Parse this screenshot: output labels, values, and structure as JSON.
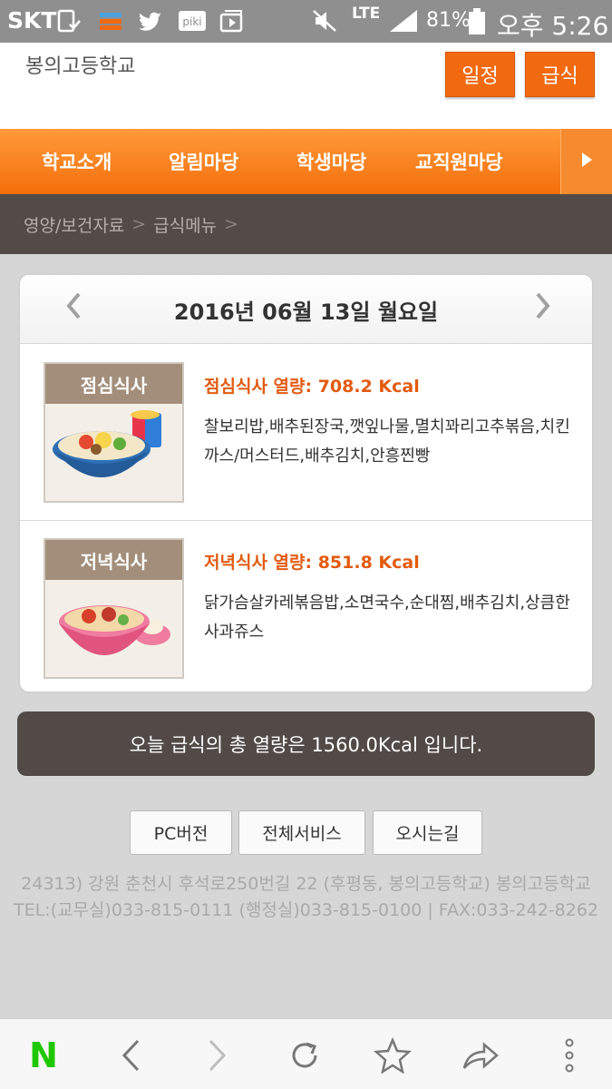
{
  "status_bar": {
    "carrier": "SKT",
    "network": "LTE",
    "battery": "81%",
    "time": "오후 5:26",
    "icons": [
      "phone-check-icon",
      "stack-icon",
      "twitter-icon",
      "piki-icon",
      "media-icon",
      "mute-icon",
      "signal-icon",
      "battery-icon"
    ],
    "piki_label": "piki"
  },
  "header": {
    "site_title": "봉의고등학교",
    "schedule_label": "일정",
    "meal_label": "급식",
    "accent": "#f26a10"
  },
  "nav": {
    "items": [
      "학교소개",
      "알림마당",
      "학생마당",
      "교직원마당"
    ],
    "next_icon": "play-arrow-icon"
  },
  "breadcrumb": {
    "items": [
      "영양/보건자료",
      "급식메뉴"
    ],
    "separator": ">"
  },
  "meal_card": {
    "date": "2016년 06월 13일 월요일",
    "prev_icon": "chevron-left-icon",
    "next_icon": "chevron-right-icon",
    "lunch": {
      "tag": "점심식사",
      "calories": "점심식사 열량: 708.2 Kcal",
      "menu": "찰보리밥,배추된장국,깻잎나물,멸치꽈리고추볶음,치킨까스/머스터드,배추김치,안흥찐빵"
    },
    "dinner": {
      "tag": "저녁식사",
      "calories": "저녁식사 열량: 851.8 Kcal",
      "menu": "닭가슴살카레볶음밥,소면국수,순대찜,배추김치,상큼한사과쥬스"
    }
  },
  "total": "오늘 급식의 총 열량은 1560.0Kcal 입니다.",
  "footer": {
    "buttons": [
      "PC버전",
      "전체서비스",
      "오시는길"
    ],
    "address": "24313) 강원 춘천시 후석로250번길 22 (후평동, 봉의고등학교) 봉의고등학교",
    "contact": "TEL:(교무실)033-815-0111 (행정실)033-815-0100 | FAX:033-242-8262"
  },
  "browser_bar": {
    "naver_label": "N",
    "icons": [
      "naver-icon",
      "back-icon",
      "forward-icon",
      "reload-icon",
      "bookmark-star-icon",
      "share-icon",
      "more-icon"
    ]
  }
}
